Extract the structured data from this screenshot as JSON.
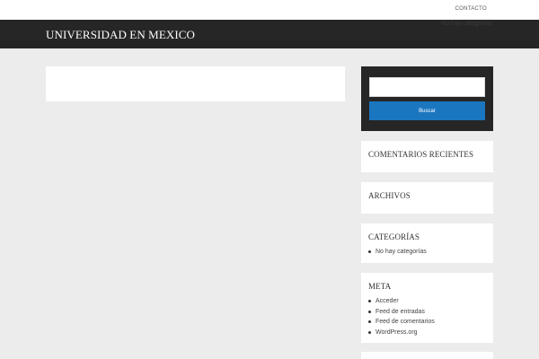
{
  "topbar": {
    "contact_label": "CONTACTO"
  },
  "header": {
    "site_title": "UNIVERSIDAD EN MEXICO",
    "menu_note": "No hay categorías"
  },
  "search": {
    "placeholder": "",
    "button_label": "Buscar"
  },
  "widgets": {
    "recent_comments": {
      "title": "COMENTARIOS RECIENTES"
    },
    "archives": {
      "title": "ARCHIVOS"
    },
    "categories": {
      "title": "CATEGORÍAS",
      "items": [
        "No hay categorías"
      ]
    },
    "meta": {
      "title": "META",
      "items": [
        "Acceder",
        "Feed de entradas",
        "Feed de comentarios",
        "WordPress.org"
      ]
    }
  },
  "colors": {
    "page_bg": "#ececec",
    "header_bg": "#262626",
    "accent_button": "#1b76c0",
    "card_bg": "#ffffff"
  }
}
